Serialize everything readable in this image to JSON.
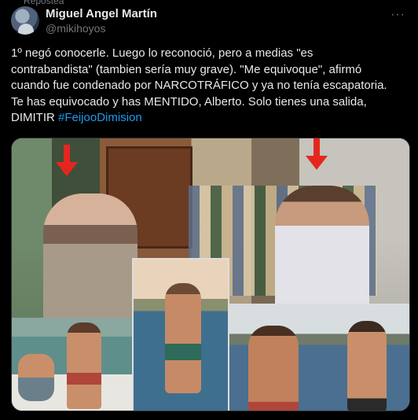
{
  "header": {
    "reposted_hint": "Repostea",
    "author_name": "Miguel Angel Martín",
    "author_handle": "@mikihoyos",
    "more_label": "···"
  },
  "post": {
    "lines": [
      "1º negó conocerle. Luego lo reconoció, pero a medias \"es",
      "contrabandista\" (tambien sería muy grave). \"Me equivoque\", afirmó",
      "cuando fue condenado por NARCOTRÁFICO y ya no tenía escapatoria.",
      "Te has equivocado y has MENTIDO, Alberto. Solo tienes una salida,"
    ],
    "last_line_text": "DIMITIR ",
    "hashtag": "#FeijooDimision"
  },
  "media": {
    "arrow_color": "#e5261f",
    "link_color": "#1d9bf0"
  }
}
